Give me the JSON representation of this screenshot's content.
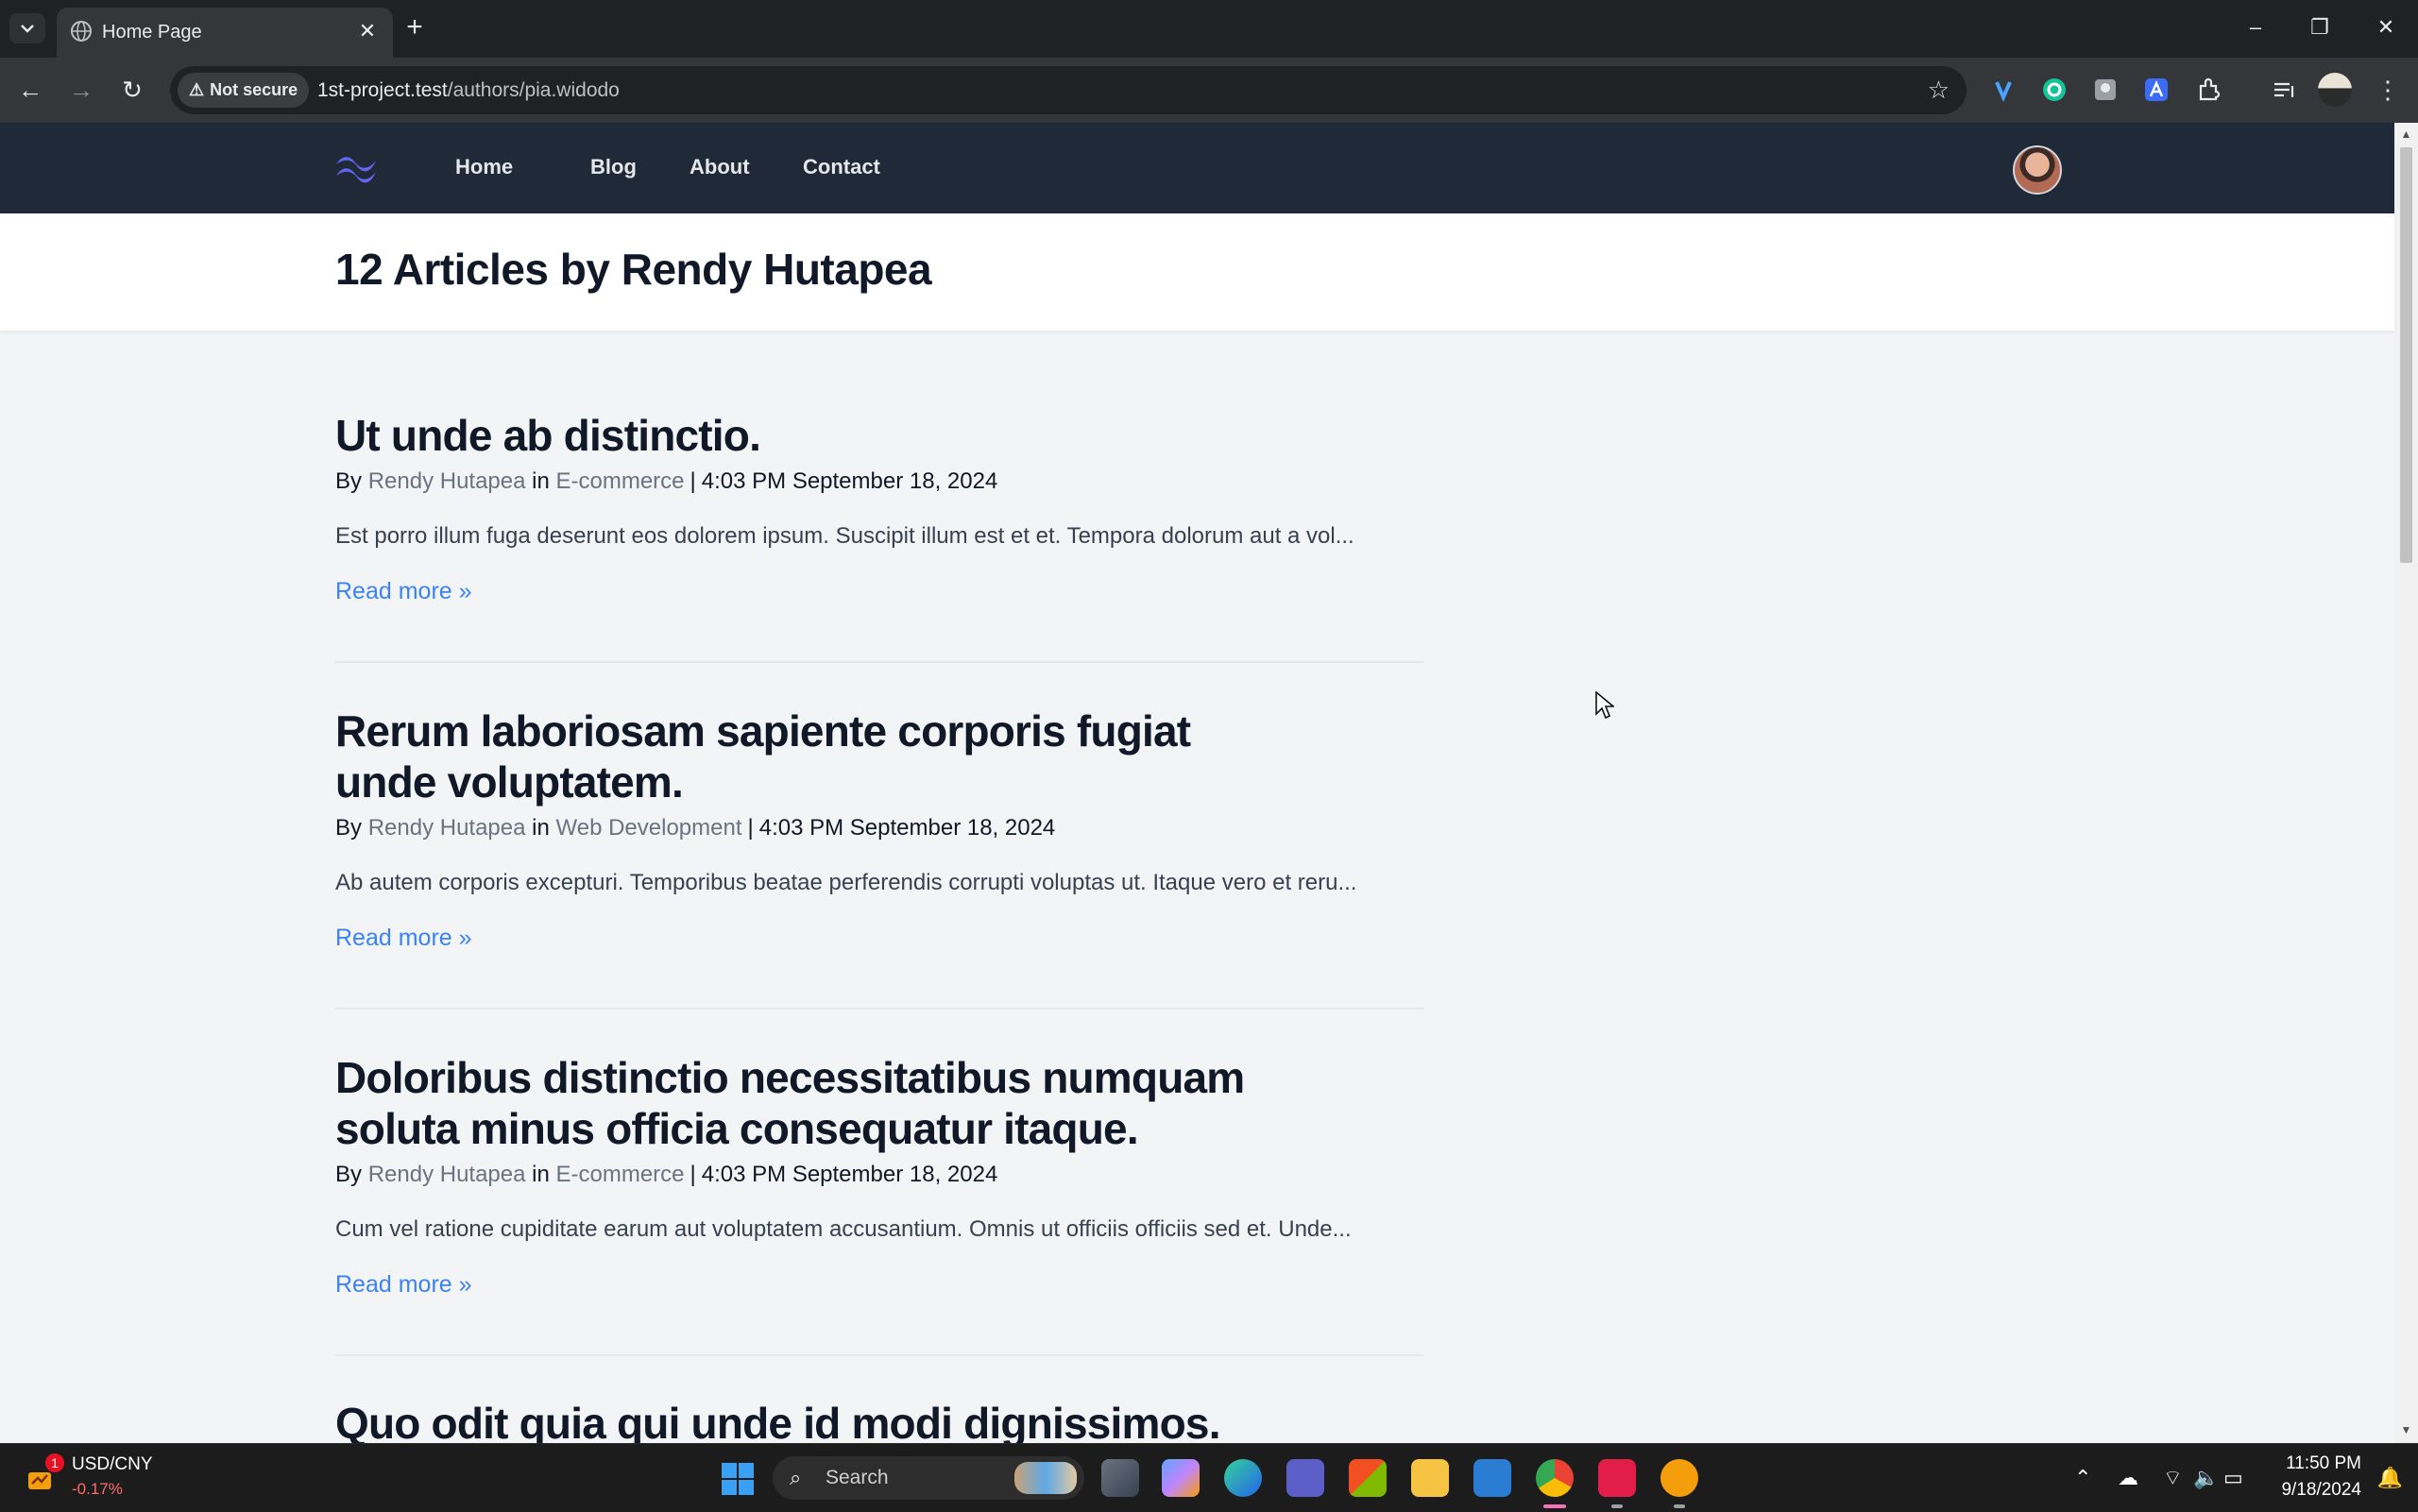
{
  "browser": {
    "tab_title": "Home Page",
    "security_label": "Not secure",
    "url_host": "1st-project.test",
    "url_path": "/authors/pia.widodo"
  },
  "site": {
    "nav": [
      "Home",
      "Blog",
      "About",
      "Contact"
    ],
    "page_title": "12 Articles by Rendy Hutapea"
  },
  "articles": [
    {
      "title": "Ut unde ab distinctio.",
      "by": "By",
      "author": "Rendy Hutapea",
      "in": "in",
      "category": "E-commerce",
      "separator": "|",
      "date": "4:03 PM September 18, 2024",
      "excerpt": "Est porro illum fuga deserunt eos dolorem ipsum. Suscipit illum est et et. Tempora dolorum aut a vol...",
      "read_more": "Read more »"
    },
    {
      "title": "Rerum laboriosam sapiente corporis fugiat unde voluptatem.",
      "by": "By",
      "author": "Rendy Hutapea",
      "in": "in",
      "category": "Web Development",
      "separator": "|",
      "date": "4:03 PM September 18, 2024",
      "excerpt": "Ab autem corporis excepturi. Temporibus beatae perferendis corrupti voluptas ut. Itaque vero et reru...",
      "read_more": "Read more »"
    },
    {
      "title": "Doloribus distinctio necessitatibus numquam soluta minus officia consequatur itaque.",
      "by": "By",
      "author": "Rendy Hutapea",
      "in": "in",
      "category": "E-commerce",
      "separator": "|",
      "date": "4:03 PM September 18, 2024",
      "excerpt": "Cum vel ratione cupiditate earum aut voluptatem accusantium. Omnis ut officiis officiis sed et. Unde...",
      "read_more": "Read more »"
    },
    {
      "title": "Quo odit quia qui unde id modi dignissimos."
    }
  ],
  "taskbar": {
    "ticker_badge": "1",
    "ticker_name": "USD/CNY",
    "ticker_change": "-0.17%",
    "search_label": "Search",
    "time": "11:50 PM",
    "date": "9/18/2024"
  },
  "colors": {
    "nav_bg": "#1f2937",
    "page_bg": "#f3f4f6",
    "link_blue": "#3b82f6",
    "muted_text": "#6b7280",
    "logo_accent": "#6366f1"
  },
  "icons": [
    "globe-icon",
    "close-icon",
    "plus-icon",
    "back-arrow-icon",
    "forward-arrow-icon",
    "reload-icon",
    "warning-icon",
    "star-icon",
    "extensions-icon",
    "windows-start-icon",
    "search-icon",
    "notification-bell-icon",
    "wifi-icon",
    "volume-icon",
    "battery-icon",
    "cloud-icon"
  ]
}
